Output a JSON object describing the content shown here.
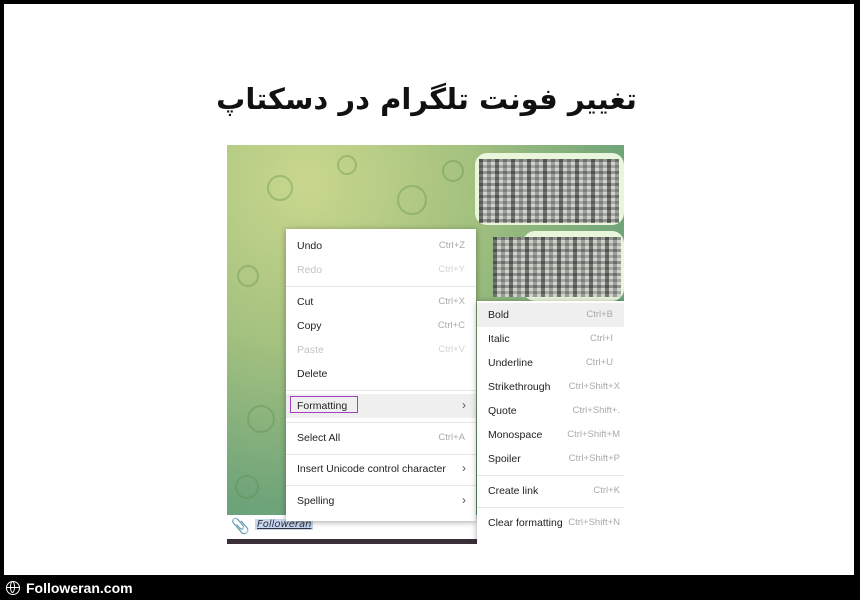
{
  "title": "تغییر فونت تلگرام در دسکتاپ",
  "input": {
    "text": "Followeran"
  },
  "context_menu": {
    "items": [
      {
        "label": "Undo",
        "shortcut": "Ctrl+Z"
      },
      {
        "label": "Redo",
        "shortcut": "Ctrl+Y"
      },
      {
        "label": "Cut",
        "shortcut": "Ctrl+X"
      },
      {
        "label": "Copy",
        "shortcut": "Ctrl+C"
      },
      {
        "label": "Paste",
        "shortcut": "Ctrl+V"
      },
      {
        "label": "Delete",
        "shortcut": ""
      },
      {
        "label": "Formatting",
        "shortcut": ""
      },
      {
        "label": "Select All",
        "shortcut": "Ctrl+A"
      },
      {
        "label": "Insert Unicode control character",
        "shortcut": ""
      },
      {
        "label": "Spelling",
        "shortcut": ""
      }
    ]
  },
  "formatting_menu": {
    "items": [
      {
        "label": "Bold",
        "shortcut": "Ctrl+B"
      },
      {
        "label": "Italic",
        "shortcut": "Ctrl+I"
      },
      {
        "label": "Underline",
        "shortcut": "Ctrl+U"
      },
      {
        "label": "Strikethrough",
        "shortcut": "Ctrl+Shift+X"
      },
      {
        "label": "Quote",
        "shortcut": "Ctrl+Shift+."
      },
      {
        "label": "Monospace",
        "shortcut": "Ctrl+Shift+M"
      },
      {
        "label": "Spoiler",
        "shortcut": "Ctrl+Shift+P"
      },
      {
        "label": "Create link",
        "shortcut": "Ctrl+K"
      },
      {
        "label": "Clear formatting",
        "shortcut": "Ctrl+Shift+N"
      }
    ]
  },
  "footer": {
    "brand": "Followeran.com"
  },
  "colors": {
    "highlight_border": "#a640c0",
    "chat_bg": "#7aa86e",
    "bubble": "#eaf6dc"
  },
  "icons": {
    "attach": "paperclip-icon",
    "submenu": "chevron-right-icon",
    "brand": "globe-icon"
  }
}
